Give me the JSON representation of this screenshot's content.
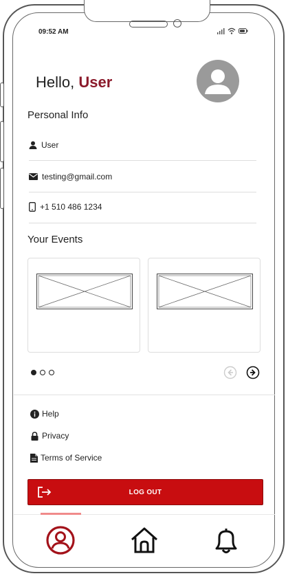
{
  "status": {
    "time": "09:52 AM"
  },
  "header": {
    "greeting": "Hello,",
    "user_name": "User"
  },
  "personal_info": {
    "title": "Personal Info",
    "name": "User",
    "email": "testing@gmail.com",
    "phone": "+1 510 486 1234"
  },
  "events": {
    "title": "Your Events",
    "cards": [
      {
        "label": "event-image-1"
      },
      {
        "label": "event-image-2"
      }
    ],
    "pagination": {
      "current": 1,
      "total": 3
    }
  },
  "menu": {
    "help": "Help",
    "privacy": "Privacy",
    "terms": "Terms of Service"
  },
  "logout": {
    "label": "LOG OUT"
  },
  "colors": {
    "accent": "#c80d10",
    "name": "#8b1a2b",
    "nav_active": "#a3121a"
  },
  "bottom_nav": {
    "items": [
      "profile-icon",
      "home-icon",
      "bell-icon"
    ],
    "active": "profile-icon"
  }
}
